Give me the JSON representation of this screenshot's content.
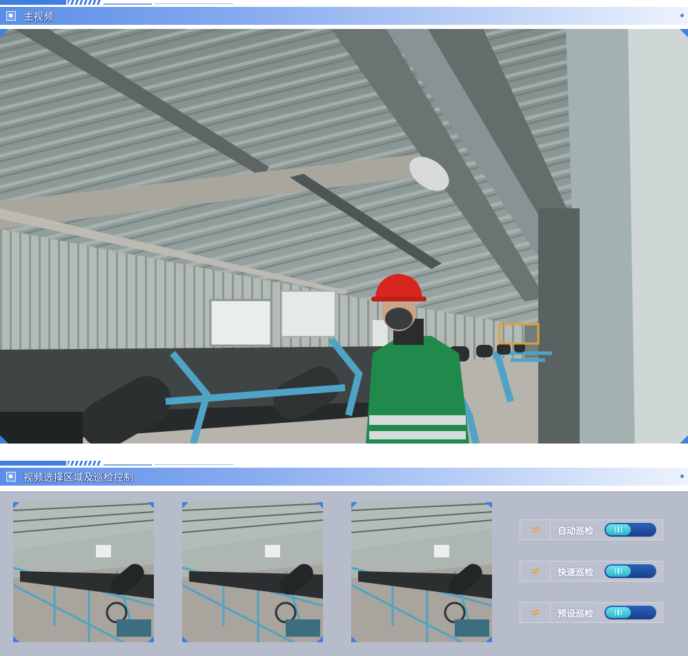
{
  "main_section": {
    "title": "主视频"
  },
  "lower_section": {
    "title": "视频选择区域及巡检控制"
  },
  "thumbnails": [
    {
      "name": "video-thumbnail-1"
    },
    {
      "name": "video-thumbnail-2"
    },
    {
      "name": "video-thumbnail-3"
    }
  ],
  "controls": [
    {
      "label": "自动巡检",
      "icon": "patrol-loop-icon"
    },
    {
      "label": "快速巡检",
      "icon": "patrol-loop-icon"
    },
    {
      "label": "预设巡检",
      "icon": "patrol-loop-icon"
    }
  ],
  "colors": {
    "accent": "#3f7fe0",
    "panel_bg": "#b7bccb",
    "toggle_knob": "#3fc6da",
    "icon_orange": "#f0a040"
  }
}
